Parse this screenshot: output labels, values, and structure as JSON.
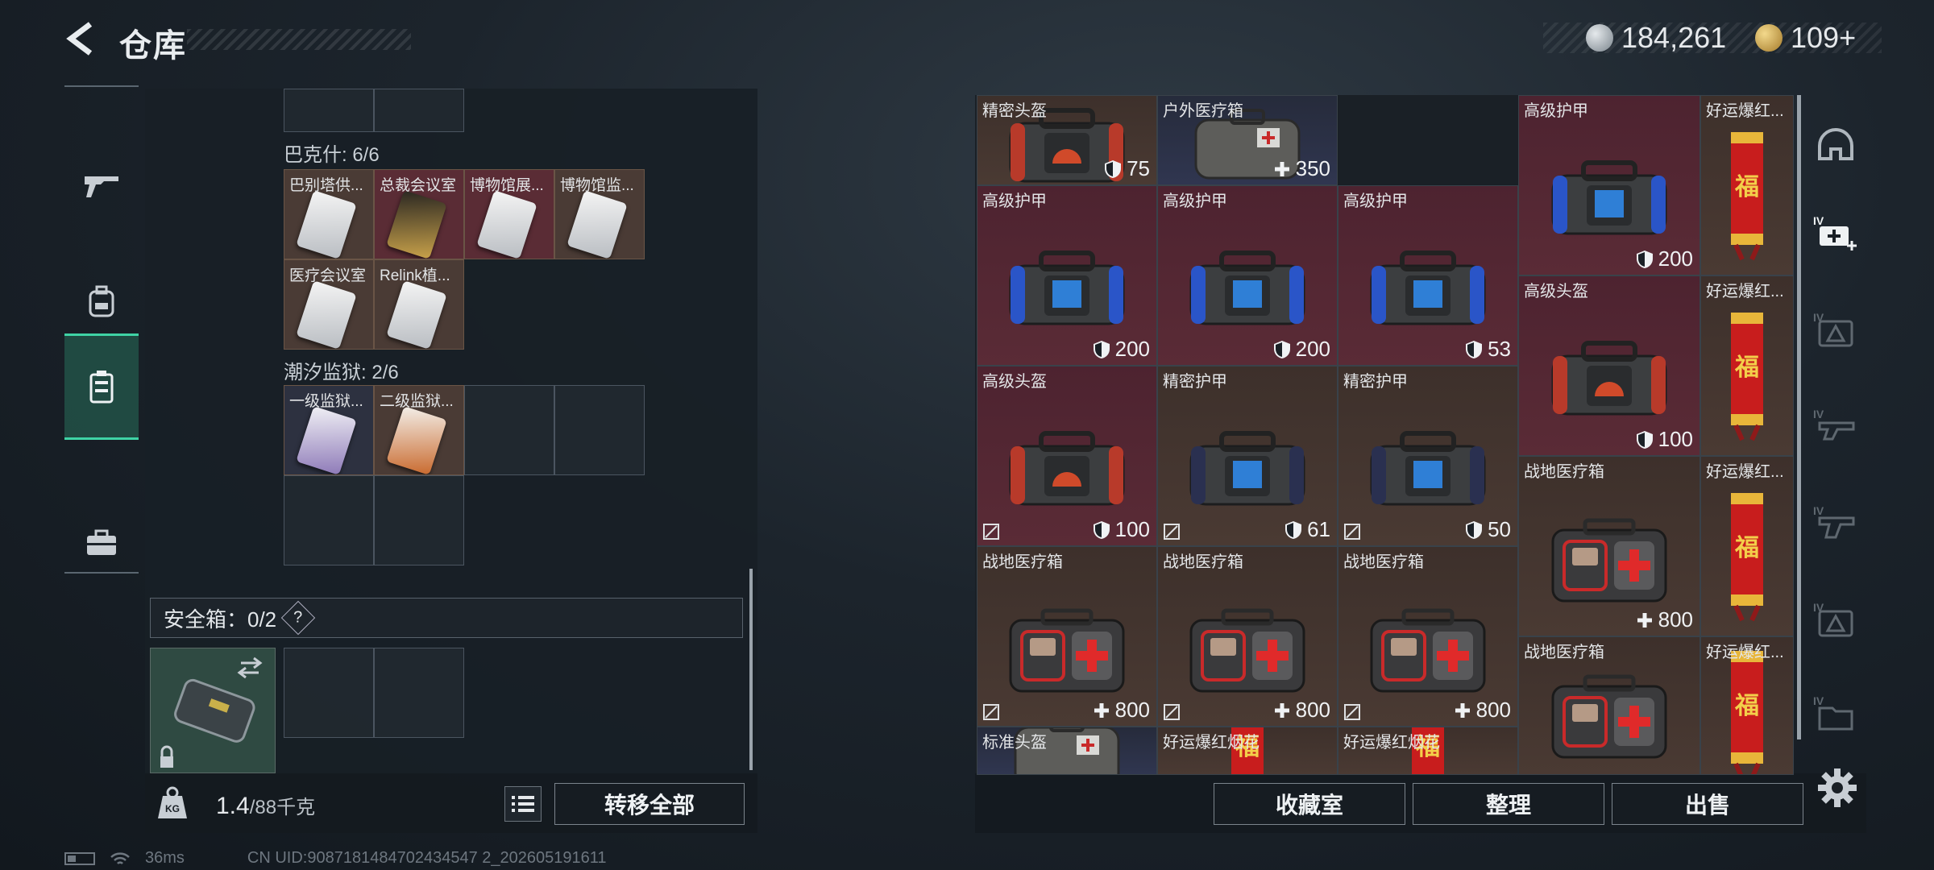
{
  "header": {
    "title": "仓库"
  },
  "currency": [
    {
      "icon": "silver-coin-icon",
      "value": "184,261"
    },
    {
      "icon": "gold-coin-icon",
      "value": "109+"
    }
  ],
  "stash": {
    "groups": [
      {
        "label": "巴克什: 6/6",
        "items": [
          "巴别塔供...",
          "总裁会议室",
          "博物馆展...",
          "博物馆监...",
          "医疗会议室",
          "Relink植..."
        ]
      },
      {
        "label": "潮汐监狱: 2/6",
        "items": [
          "一级监狱...",
          "二级监狱..."
        ]
      }
    ],
    "safe_box_label": "安全箱：0/2",
    "safe_help": "?",
    "weight_value": "1.4",
    "weight_unit": "/88千克",
    "transfer_all": "转移全部"
  },
  "inventory": {
    "items": [
      {
        "name": "精密头盔",
        "value": "75",
        "value_icon": "shield-icon",
        "color": "brown"
      },
      {
        "name": "户外医疗箱",
        "value": "350",
        "value_icon": "plus-icon",
        "color": "blue"
      },
      {
        "name": "高级护甲",
        "value": "200",
        "value_icon": "shield-icon",
        "color": "red"
      },
      {
        "name": "好运爆红...",
        "value": "",
        "color": "brown"
      },
      {
        "name": "高级护甲",
        "value": "200",
        "value_icon": "shield-icon",
        "color": "red"
      },
      {
        "name": "高级护甲",
        "value": "200",
        "value_icon": "shield-icon",
        "color": "red"
      },
      {
        "name": "高级护甲",
        "value": "53",
        "value_icon": "shield-icon",
        "color": "red"
      },
      {
        "name": "高级头盔",
        "value": "100",
        "value_icon": "shield-icon",
        "color": "red"
      },
      {
        "name": "好运爆红...",
        "value": "",
        "color": "brown"
      },
      {
        "name": "高级头盔",
        "value": "100",
        "value_icon": "shield-icon",
        "color": "red"
      },
      {
        "name": "精密护甲",
        "value": "61",
        "value_icon": "shield-icon",
        "color": "brown"
      },
      {
        "name": "精密护甲",
        "value": "50",
        "value_icon": "shield-icon",
        "color": "brown"
      },
      {
        "name": "战地医疗箱",
        "value": "800",
        "value_icon": "plus-icon",
        "color": "brown"
      },
      {
        "name": "好运爆红...",
        "value": "",
        "color": "brown"
      },
      {
        "name": "战地医疗箱",
        "value": "800",
        "value_icon": "plus-icon",
        "color": "brown"
      },
      {
        "name": "战地医疗箱",
        "value": "800",
        "value_icon": "plus-icon",
        "color": "brown"
      },
      {
        "name": "战地医疗箱",
        "value": "800",
        "value_icon": "plus-icon",
        "color": "brown"
      },
      {
        "name": "战地医疗箱",
        "value": "",
        "color": "brown"
      },
      {
        "name": "好运爆红...",
        "value": "",
        "color": "brown"
      },
      {
        "name": "标准头盔",
        "value": "",
        "color": "blue"
      },
      {
        "name": "好运爆红烟花",
        "value": "",
        "color": "brown"
      },
      {
        "name": "好运爆红烟花",
        "value": "",
        "color": "brown"
      }
    ],
    "buttons": {
      "collection": "收藏室",
      "sort": "整理",
      "sell": "出售"
    }
  },
  "status": {
    "ping": "36ms",
    "uid": "CN UID:9087181484702434547 2_202605191611"
  },
  "colors": {
    "accent": "#3fd3a5",
    "item_red": "#5a2b36",
    "item_brown": "#4a3a33",
    "item_blue": "#303650"
  }
}
